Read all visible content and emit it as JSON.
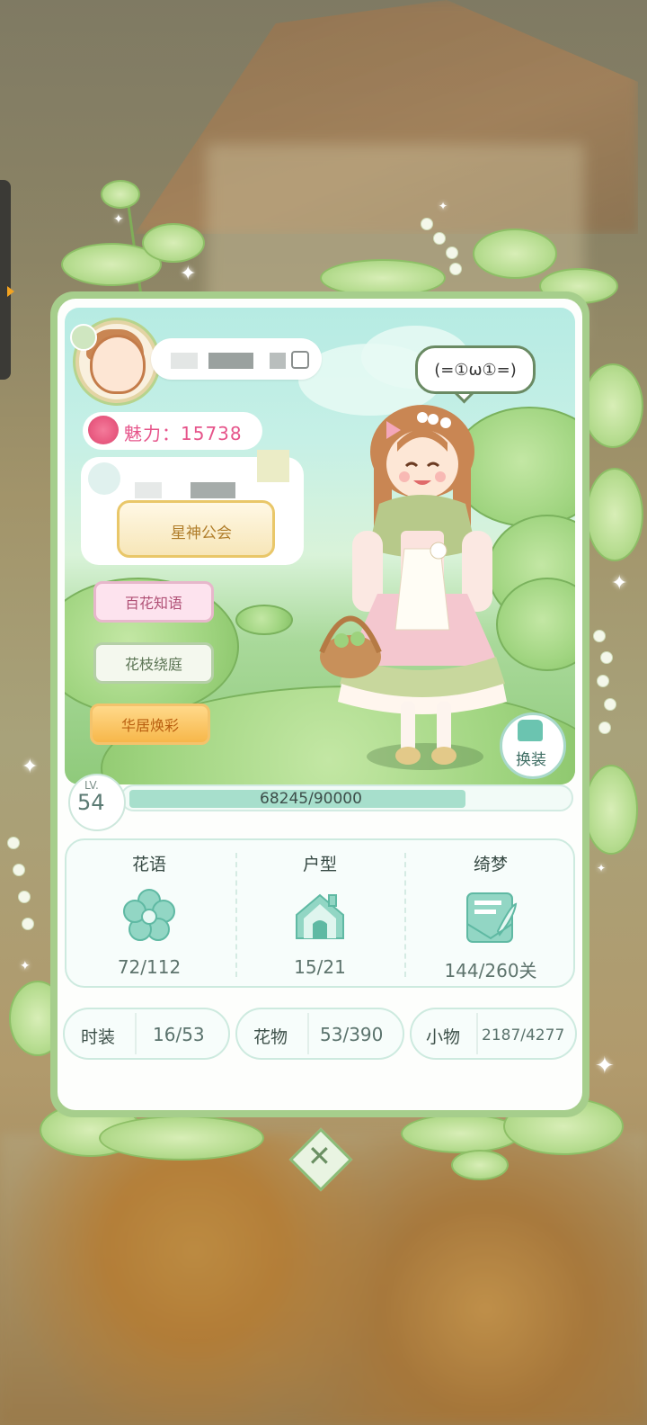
{
  "profile": {
    "charm_text": "魅力：15738",
    "guild_name": "星神公会",
    "speech_bubble": "(=①ω①=)"
  },
  "menu_buttons": {
    "hundred_flowers": "百花知语",
    "flower_courtyard": "花枝绕庭",
    "house_makeover": "华居焕彩"
  },
  "change_outfit_label": "换装",
  "level": {
    "label": "LV.",
    "value": "54",
    "exp_text": "68245/90000",
    "exp_fraction": 0.758
  },
  "stats": [
    {
      "title": "花语",
      "value": "72/112",
      "icon": "flower-icon"
    },
    {
      "title": "户型",
      "value": "15/21",
      "icon": "house-icon"
    },
    {
      "title": "绮梦",
      "value": "144/260关",
      "icon": "dream-letter-icon"
    }
  ],
  "collections": [
    {
      "label": "时装",
      "value": "16/53"
    },
    {
      "label": "花物",
      "value": "53/390"
    },
    {
      "label": "小物",
      "value": "2187/4277"
    }
  ],
  "colors": {
    "accent_green": "#a6ce8c",
    "teal": "#6bc4b0",
    "charm_pink": "#e6548a"
  }
}
